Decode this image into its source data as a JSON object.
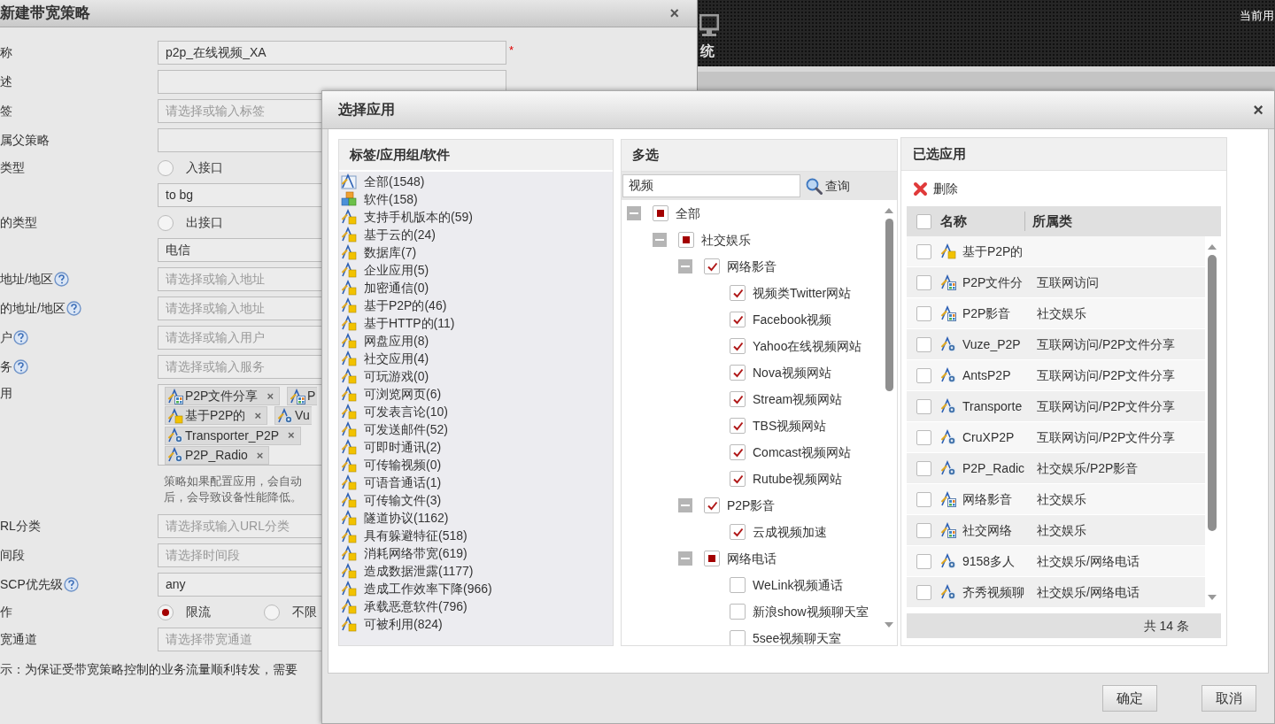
{
  "banner": {
    "menu_label": "统",
    "user_text": "当前用"
  },
  "policy_dialog": {
    "title": "新建带宽策略",
    "close": "×",
    "rows": [
      {
        "kind": "input",
        "label": "称",
        "value": "p2p_在线视频_XA",
        "required": "*"
      },
      {
        "kind": "input",
        "label": "述"
      },
      {
        "kind": "input",
        "label": "签",
        "placeholder": "请选择或输入标签"
      },
      {
        "kind": "input",
        "label": "属父策略"
      },
      {
        "kind": "radio",
        "label": "类型",
        "options": [
          {
            "label": "入接口",
            "selected": false
          }
        ]
      },
      {
        "kind": "input",
        "value": "to bg"
      },
      {
        "kind": "radio",
        "label": "的类型",
        "options": [
          {
            "label": "出接口",
            "selected": false
          }
        ]
      },
      {
        "kind": "input",
        "value": "电信"
      },
      {
        "kind": "input",
        "label": "地址/地区",
        "help": true,
        "placeholder": "请选择或输入地址"
      },
      {
        "kind": "input",
        "label": "的地址/地区",
        "help": true,
        "placeholder": "请选择或输入地址"
      },
      {
        "kind": "input",
        "label": "户",
        "help": true,
        "placeholder": "请选择或输入用户"
      },
      {
        "kind": "input",
        "label": "务",
        "help": true,
        "placeholder": "请选择或输入服务"
      },
      {
        "kind": "tags",
        "label": "用",
        "tag_rows": [
          [
            {
              "label": "P2P文件分享",
              "kind": "group",
              "remove": "×"
            },
            {
              "label": "P",
              "kind": "group"
            }
          ],
          [
            {
              "label": "基于P2P的",
              "kind": "tag",
              "remove": "×"
            },
            {
              "label": "Vu",
              "kind": "app"
            }
          ],
          [
            {
              "label": "Transporter_P2P",
              "kind": "app",
              "remove": "×"
            }
          ],
          [
            {
              "label": "P2P_Radio",
              "kind": "app",
              "remove": "×"
            }
          ]
        ]
      },
      {
        "kind": "note",
        "lines": [
          "策略如果配置应用，会自动",
          "后，会导致设备性能降低。"
        ]
      },
      {
        "kind": "input",
        "label": "RL分类",
        "placeholder": "请选择或输入URL分类"
      },
      {
        "kind": "input",
        "label": "间段",
        "placeholder": "请选择时间段"
      },
      {
        "kind": "input",
        "label": "SCP优先级",
        "help": true,
        "value": "any"
      },
      {
        "kind": "radio",
        "label": "作",
        "options": [
          {
            "label": "限流",
            "selected": true
          },
          {
            "label": "不限",
            "selected": false
          }
        ]
      },
      {
        "kind": "input",
        "label": "宽通道",
        "placeholder": "请选择带宽通道"
      },
      {
        "kind": "tip",
        "text": "示：为保证受带宽策略控制的业务流量顺利转发，需要"
      }
    ]
  },
  "app_dialog": {
    "title": "选择应用",
    "close": "×",
    "categories": {
      "title": "标签/应用组/软件",
      "items": [
        {
          "label": "全部(1548)",
          "kind": "all"
        },
        {
          "label": "软件(158)",
          "kind": "software"
        },
        {
          "label": "支持手机版本的(59)",
          "kind": "tag"
        },
        {
          "label": "基于云的(24)",
          "kind": "tag"
        },
        {
          "label": "数据库(7)",
          "kind": "tag"
        },
        {
          "label": "企业应用(5)",
          "kind": "tag"
        },
        {
          "label": "加密通信(0)",
          "kind": "tag"
        },
        {
          "label": "基于P2P的(46)",
          "kind": "tag"
        },
        {
          "label": "基于HTTP的(11)",
          "kind": "tag"
        },
        {
          "label": "网盘应用(8)",
          "kind": "tag"
        },
        {
          "label": "社交应用(4)",
          "kind": "tag"
        },
        {
          "label": "可玩游戏(0)",
          "kind": "tag"
        },
        {
          "label": "可浏览网页(6)",
          "kind": "tag"
        },
        {
          "label": "可发表言论(10)",
          "kind": "tag"
        },
        {
          "label": "可发送邮件(52)",
          "kind": "tag"
        },
        {
          "label": "可即时通讯(2)",
          "kind": "tag"
        },
        {
          "label": "可传输视频(0)",
          "kind": "tag"
        },
        {
          "label": "可语音通话(1)",
          "kind": "tag"
        },
        {
          "label": "可传输文件(3)",
          "kind": "tag"
        },
        {
          "label": "隧道协议(1162)",
          "kind": "tag"
        },
        {
          "label": "具有躲避特征(518)",
          "kind": "tag"
        },
        {
          "label": "消耗网络带宽(619)",
          "kind": "tag"
        },
        {
          "label": "造成数据泄露(1177)",
          "kind": "tag"
        },
        {
          "label": "造成工作效率下降(966)",
          "kind": "tag"
        },
        {
          "label": "承载恶意软件(796)",
          "kind": "tag"
        },
        {
          "label": "可被利用(824)",
          "kind": "tag"
        }
      ]
    },
    "multi": {
      "title": "多选",
      "search": {
        "value": "视频",
        "button": "查询"
      },
      "tree": [
        {
          "label": "全部",
          "checked": false,
          "partial": true,
          "expanded": true,
          "children": [
            {
              "label": "社交娱乐",
              "checked": false,
              "partial": true,
              "expanded": true,
              "children": [
                {
                  "label": "网络影音",
                  "checked": true,
                  "partial": false,
                  "expanded": true,
                  "children": [
                    {
                      "label": "视频类Twitter网站",
                      "checked": true,
                      "partial": false
                    },
                    {
                      "label": "Facebook视频",
                      "checked": true,
                      "partial": false
                    },
                    {
                      "label": "Yahoo在线视频网站",
                      "checked": true,
                      "partial": false
                    },
                    {
                      "label": "Nova视频网站",
                      "checked": true,
                      "partial": false
                    },
                    {
                      "label": "Stream视频网站",
                      "checked": true,
                      "partial": false
                    },
                    {
                      "label": "TBS视频网站",
                      "checked": true,
                      "partial": false
                    },
                    {
                      "label": "Comcast视频网站",
                      "checked": true,
                      "partial": false
                    },
                    {
                      "label": "Rutube视频网站",
                      "checked": true,
                      "partial": false
                    }
                  ]
                },
                {
                  "label": "P2P影音",
                  "checked": true,
                  "partial": false,
                  "expanded": true,
                  "children": [
                    {
                      "label": "云成视频加速",
                      "checked": true,
                      "partial": false
                    }
                  ]
                },
                {
                  "label": "网络电话",
                  "checked": false,
                  "partial": true,
                  "expanded": true,
                  "children": [
                    {
                      "label": "WeLink视频通话",
                      "checked": false,
                      "partial": false
                    },
                    {
                      "label": "新浪show视频聊天室",
                      "checked": false,
                      "partial": false
                    },
                    {
                      "label": "5see视频聊天室",
                      "checked": false,
                      "partial": false
                    }
                  ]
                }
              ]
            }
          ]
        }
      ]
    },
    "selected": {
      "title": "已选应用",
      "delete_label": "删除",
      "columns": [
        "名称",
        "所属类"
      ],
      "select_all": {
        "checked": false
      },
      "rows": [
        {
          "name": "基于P2P的",
          "kind": "tag",
          "checked": false
        },
        {
          "name": "P2P文件分",
          "category": "互联网访问",
          "kind": "group",
          "checked": false
        },
        {
          "name": "P2P影音",
          "category": "社交娱乐",
          "kind": "group",
          "checked": false
        },
        {
          "name": "Vuze_P2P",
          "category": "互联网访问/P2P文件分享",
          "kind": "app",
          "checked": false
        },
        {
          "name": "AntsP2P",
          "category": "互联网访问/P2P文件分享",
          "kind": "app",
          "checked": false
        },
        {
          "name": "Transporte",
          "category": "互联网访问/P2P文件分享",
          "kind": "app",
          "checked": false
        },
        {
          "name": "CruXP2P",
          "category": "互联网访问/P2P文件分享",
          "kind": "app",
          "checked": false
        },
        {
          "name": "P2P_Radic",
          "category": "社交娱乐/P2P影音",
          "kind": "app",
          "checked": false
        },
        {
          "name": "网络影音",
          "category": "社交娱乐",
          "kind": "group",
          "checked": false
        },
        {
          "name": "社交网络",
          "category": "社交娱乐",
          "kind": "group",
          "checked": false
        },
        {
          "name": "9158多人",
          "category": "社交娱乐/网络电话",
          "kind": "app",
          "checked": false
        },
        {
          "name": "齐秀视频聊",
          "category": "社交娱乐/网络电话",
          "kind": "app",
          "checked": false
        }
      ],
      "footer": "共 14 条"
    },
    "buttons": [
      "确定",
      "取消"
    ]
  }
}
